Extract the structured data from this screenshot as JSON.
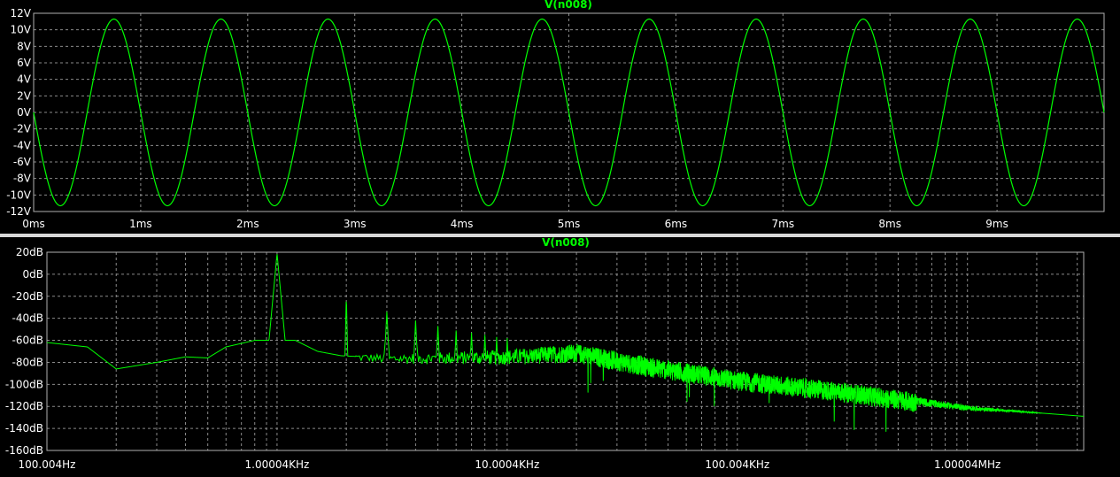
{
  "colors": {
    "background": "#000000",
    "grid": "#8a8a8a",
    "frame": "#b0b0b0",
    "text": "#ffffff",
    "trace": "#00ff00",
    "divider": "#d8d8d8"
  },
  "chart_data": [
    {
      "type": "line",
      "title": "V(n008)",
      "xlabel": "",
      "ylabel": "",
      "xlim": [
        0,
        10
      ],
      "ylim": [
        -12,
        12
      ],
      "x_ticks": [
        0,
        1,
        2,
        3,
        4,
        5,
        6,
        7,
        8,
        9
      ],
      "x_tick_labels": [
        "0ms",
        "1ms",
        "2ms",
        "3ms",
        "4ms",
        "5ms",
        "6ms",
        "7ms",
        "8ms",
        "9ms"
      ],
      "y_ticks": [
        12,
        10,
        8,
        6,
        4,
        2,
        0,
        -2,
        -4,
        -6,
        -8,
        -10,
        -12
      ],
      "y_tick_labels": [
        "12V",
        "10V",
        "8V",
        "6V",
        "4V",
        "2V",
        "0V",
        "-2V",
        "-4V",
        "-6V",
        "-8V",
        "-10V",
        "-12V"
      ],
      "grid": true,
      "series": [
        {
          "name": "V(n008)",
          "waveform": "sine",
          "amplitude": 11.3,
          "period_ms": 1.0,
          "x": [
            0,
            0.25,
            0.5,
            0.75,
            1,
            1.25,
            1.5,
            1.75,
            2,
            2.25,
            2.5,
            2.75,
            3,
            3.25,
            3.5,
            3.75,
            4,
            4.25,
            4.5,
            4.75,
            5,
            5.25,
            5.5,
            5.75,
            6,
            6.25,
            6.5,
            6.75,
            7,
            7.25,
            7.5,
            7.75,
            8,
            8.25,
            8.5,
            8.75,
            9,
            9.25,
            9.5,
            9.75,
            10
          ],
          "y": [
            0,
            -11.3,
            0,
            11.3,
            0,
            -11.3,
            0,
            11.3,
            0,
            -11.3,
            0,
            11.3,
            0,
            -11.3,
            0,
            11.3,
            0,
            -11.3,
            0,
            11.3,
            0,
            -11.3,
            0,
            11.3,
            0,
            -11.3,
            0,
            11.3,
            0,
            -11.3,
            0,
            11.3,
            0,
            -11.3,
            0,
            11.3,
            0,
            -11.3,
            0,
            11.3,
            0
          ]
        }
      ]
    },
    {
      "type": "line",
      "title": "V(n008)",
      "xlabel": "",
      "ylabel": "",
      "x_scale": "log",
      "xlim": [
        100.004,
        3200000
      ],
      "ylim": [
        -160,
        20
      ],
      "x_ticks": [
        100.004,
        1000.04,
        10000.4,
        100004,
        1000040
      ],
      "x_tick_labels": [
        "100.004Hz",
        "1.00004KHz",
        "10.0004KHz",
        "100.004KHz",
        "1.00004MHz"
      ],
      "y_ticks": [
        20,
        0,
        -20,
        -40,
        -60,
        -80,
        -100,
        -120,
        -140,
        -160
      ],
      "y_tick_labels": [
        "20dB",
        "0dB",
        "-20dB",
        "-40dB",
        "-60dB",
        "-80dB",
        "-100dB",
        "-120dB",
        "-140dB",
        "-160dB"
      ],
      "grid": true,
      "series": [
        {
          "name": "V(n008)",
          "fundamental_hz": 1000,
          "harmonics": [
            {
              "freq": 1000,
              "db": 19
            },
            {
              "freq": 2000,
              "db": -18
            },
            {
              "freq": 3000,
              "db": -34
            },
            {
              "freq": 4000,
              "db": -42
            },
            {
              "freq": 5000,
              "db": -47
            },
            {
              "freq": 6000,
              "db": -51
            },
            {
              "freq": 7000,
              "db": -53
            },
            {
              "freq": 8000,
              "db": -55
            },
            {
              "freq": 9000,
              "db": -57
            },
            {
              "freq": 10000,
              "db": -58
            }
          ],
          "baseline": [
            {
              "freq": 100,
              "db": -62
            },
            {
              "freq": 150,
              "db": -66
            },
            {
              "freq": 200,
              "db": -86
            },
            {
              "freq": 300,
              "db": -80
            },
            {
              "freq": 400,
              "db": -75
            },
            {
              "freq": 500,
              "db": -76
            },
            {
              "freq": 600,
              "db": -66
            },
            {
              "freq": 800,
              "db": -60
            },
            {
              "freq": 1200,
              "db": -60
            },
            {
              "freq": 1500,
              "db": -70
            },
            {
              "freq": 1900,
              "db": -74
            },
            {
              "freq": 3000,
              "db": -76
            },
            {
              "freq": 10000,
              "db": -74
            },
            {
              "freq": 20000,
              "db": -70
            },
            {
              "freq": 40000,
              "db": -82
            },
            {
              "freq": 100000,
              "db": -95
            },
            {
              "freq": 300000,
              "db": -106
            },
            {
              "freq": 1000000,
              "db": -121
            },
            {
              "freq": 3200000,
              "db": -129
            }
          ]
        }
      ]
    }
  ]
}
